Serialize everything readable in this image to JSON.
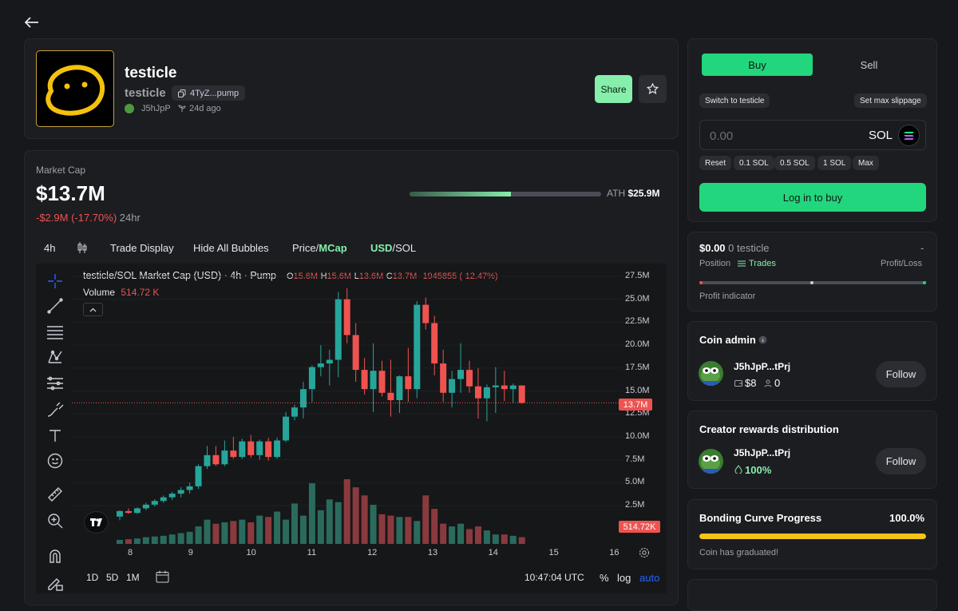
{
  "coin": {
    "name": "testicle",
    "ticker": "testicle",
    "contract": "4TyZ...pump",
    "creator": "J5hJpP",
    "age": "24d ago",
    "share_label": "Share"
  },
  "market": {
    "label": "Market Cap",
    "value": "$13.7M",
    "change": "-$2.9M (-17.70%)",
    "period": "24hr",
    "ath_label": "ATH",
    "ath_value": "$25.9M",
    "ath_progress": 0.53
  },
  "toolbar": {
    "interval": "4h",
    "trade_display": "Trade Display",
    "hide_bubbles": "Hide All Bubbles",
    "price_label": "Price",
    "mcap_label": "MCap",
    "usd_label": "USD",
    "sol_label": "SOL",
    "slash": "/"
  },
  "chart_header": {
    "title": "testicle/SOL Market Cap (USD) · 4h · Pump",
    "o_label": "O",
    "o": "15.6M",
    "h_label": "H",
    "h": "15.6M",
    "l_label": "L",
    "l": "13.6M",
    "c_label": "C",
    "c": "13.7M",
    "change": "-1945855 (-12.47%)",
    "volume_label": "Volume",
    "volume": "514.72 K"
  },
  "chart_data": {
    "type": "candlestick",
    "y_unit": "USD market cap (millions)",
    "ylim": [
      0,
      28.75
    ],
    "y_ticks": [
      "27.5M",
      "25.0M",
      "22.5M",
      "20.0M",
      "17.5M",
      "15.0M",
      "12.5M",
      "10.0M",
      "7.5M",
      "5.0M",
      "2.5M"
    ],
    "x_ticks": [
      "8",
      "9",
      "10",
      "11",
      "12",
      "13",
      "14",
      "15",
      "16"
    ],
    "current_price_label": "13.7M",
    "current_volume_label": "514.72K",
    "candles": [
      {
        "o": 1.3,
        "h": 2.0,
        "l": 0.9,
        "c": 1.9
      },
      {
        "o": 1.9,
        "h": 2.2,
        "l": 1.6,
        "c": 1.7
      },
      {
        "o": 1.7,
        "h": 2.3,
        "l": 1.6,
        "c": 2.2
      },
      {
        "o": 2.2,
        "h": 2.8,
        "l": 2.0,
        "c": 2.6
      },
      {
        "o": 2.6,
        "h": 3.2,
        "l": 2.4,
        "c": 3.0
      },
      {
        "o": 3.0,
        "h": 3.6,
        "l": 2.8,
        "c": 3.4
      },
      {
        "o": 3.4,
        "h": 4.0,
        "l": 3.1,
        "c": 3.8
      },
      {
        "o": 3.8,
        "h": 4.5,
        "l": 3.4,
        "c": 4.2
      },
      {
        "o": 4.2,
        "h": 5.0,
        "l": 3.8,
        "c": 4.6
      },
      {
        "o": 4.6,
        "h": 7.0,
        "l": 4.3,
        "c": 6.8
      },
      {
        "o": 6.8,
        "h": 9.0,
        "l": 6.5,
        "c": 8.0
      },
      {
        "o": 8.0,
        "h": 9.0,
        "l": 6.8,
        "c": 7.0
      },
      {
        "o": 7.0,
        "h": 9.6,
        "l": 6.8,
        "c": 8.5
      },
      {
        "o": 8.5,
        "h": 10.0,
        "l": 7.6,
        "c": 7.8
      },
      {
        "o": 7.8,
        "h": 9.8,
        "l": 7.6,
        "c": 9.5
      },
      {
        "o": 9.5,
        "h": 10.2,
        "l": 7.7,
        "c": 8.0
      },
      {
        "o": 8.0,
        "h": 9.7,
        "l": 7.5,
        "c": 9.5
      },
      {
        "o": 9.5,
        "h": 9.9,
        "l": 7.4,
        "c": 7.8
      },
      {
        "o": 7.8,
        "h": 9.9,
        "l": 7.6,
        "c": 9.6
      },
      {
        "o": 9.6,
        "h": 12.7,
        "l": 9.4,
        "c": 12.2
      },
      {
        "o": 12.2,
        "h": 13.5,
        "l": 11.8,
        "c": 13.2
      },
      {
        "o": 13.2,
        "h": 16.0,
        "l": 12.0,
        "c": 15.2
      },
      {
        "o": 15.2,
        "h": 17.8,
        "l": 13.8,
        "c": 17.6
      },
      {
        "o": 17.6,
        "h": 20.0,
        "l": 16.6,
        "c": 18.0
      },
      {
        "o": 18.0,
        "h": 19.5,
        "l": 15.6,
        "c": 18.4
      },
      {
        "o": 18.4,
        "h": 25.8,
        "l": 16.5,
        "c": 25.0
      },
      {
        "o": 25.0,
        "h": 26.2,
        "l": 20.2,
        "c": 21.1
      },
      {
        "o": 21.1,
        "h": 22.4,
        "l": 16.0,
        "c": 17.3
      },
      {
        "o": 17.3,
        "h": 18.6,
        "l": 14.6,
        "c": 15.2
      },
      {
        "o": 15.2,
        "h": 20.2,
        "l": 12.7,
        "c": 17.2
      },
      {
        "o": 17.2,
        "h": 18.3,
        "l": 14.4,
        "c": 14.8
      },
      {
        "o": 14.8,
        "h": 18.4,
        "l": 12.2,
        "c": 14.0
      },
      {
        "o": 14.0,
        "h": 16.7,
        "l": 12.6,
        "c": 16.6
      },
      {
        "o": 16.6,
        "h": 19.7,
        "l": 13.8,
        "c": 15.2
      },
      {
        "o": 15.2,
        "h": 24.8,
        "l": 14.2,
        "c": 24.4
      },
      {
        "o": 24.4,
        "h": 25.2,
        "l": 21.7,
        "c": 22.4
      },
      {
        "o": 22.4,
        "h": 23.2,
        "l": 16.7,
        "c": 18.0
      },
      {
        "o": 18.0,
        "h": 19.5,
        "l": 13.8,
        "c": 14.8
      },
      {
        "o": 14.8,
        "h": 17.2,
        "l": 13.2,
        "c": 16.3
      },
      {
        "o": 16.3,
        "h": 20.2,
        "l": 14.8,
        "c": 17.3
      },
      {
        "o": 17.3,
        "h": 18.3,
        "l": 14.8,
        "c": 15.5
      },
      {
        "o": 15.5,
        "h": 17.5,
        "l": 12.0,
        "c": 14.2
      },
      {
        "o": 14.2,
        "h": 15.7,
        "l": 11.7,
        "c": 15.4
      },
      {
        "o": 15.4,
        "h": 17.6,
        "l": 12.6,
        "c": 15.6
      },
      {
        "o": 15.6,
        "h": 17.2,
        "l": 13.9,
        "c": 15.2
      },
      {
        "o": 15.2,
        "h": 15.8,
        "l": 13.7,
        "c": 15.6
      },
      {
        "o": 15.6,
        "h": 15.6,
        "l": 13.6,
        "c": 13.7
      }
    ],
    "volumes": [
      0.3,
      0.35,
      0.4,
      0.5,
      0.55,
      0.6,
      0.7,
      0.8,
      0.9,
      1.3,
      1.8,
      1.5,
      1.6,
      1.7,
      1.8,
      1.6,
      2.1,
      2.0,
      2.4,
      1.8,
      3.0,
      2.1,
      4.5,
      2.5,
      3.3,
      3.1,
      4.8,
      4.2,
      3.6,
      2.9,
      2.2,
      2.1,
      2.0,
      2.0,
      1.7,
      3.6,
      2.6,
      1.5,
      1.3,
      1.5,
      1.1,
      1.3,
      1.0,
      0.7,
      0.7,
      0.6,
      0.5
    ],
    "vol_unit": "millions (USD)"
  },
  "time_controls": {
    "ranges": [
      "1D",
      "5D",
      "1M"
    ],
    "clock": "10:47:04 UTC",
    "percent": "%",
    "log": "log",
    "auto": "auto"
  },
  "trade": {
    "buy_label": "Buy",
    "sell_label": "Sell",
    "switch_label": "Switch to testicle",
    "slippage_label": "Set max slippage",
    "amount_placeholder": "0.00",
    "currency": "SOL",
    "presets": [
      "Reset",
      "0.1 SOL",
      "0.5 SOL",
      "1 SOL",
      "Max"
    ],
    "login_label": "Log in to buy"
  },
  "position": {
    "value": "$0.00",
    "qty": "0 testicle",
    "dash": "-",
    "position_label": "Position",
    "trades_label": "Trades",
    "pl_label": "Profit/Loss",
    "indicator_label": "Profit indicator"
  },
  "admin": {
    "title": "Coin admin",
    "name": "J5hJpP...tPrj",
    "balance": "$8",
    "followers": "0",
    "follow_label": "Follow"
  },
  "rewards": {
    "title": "Creator rewards distribution",
    "name": "J5hJpP...tPrj",
    "percent": "100%",
    "follow_label": "Follow"
  },
  "bonding": {
    "title": "Bonding Curve Progress",
    "percent": "100.0%",
    "progress": 1.0,
    "status": "Coin has graduated!"
  },
  "colors": {
    "green": "#22d67d",
    "up": "#26a69a",
    "down": "#ef5350",
    "accent": "#2962ff",
    "bonding": "#f5c518"
  }
}
